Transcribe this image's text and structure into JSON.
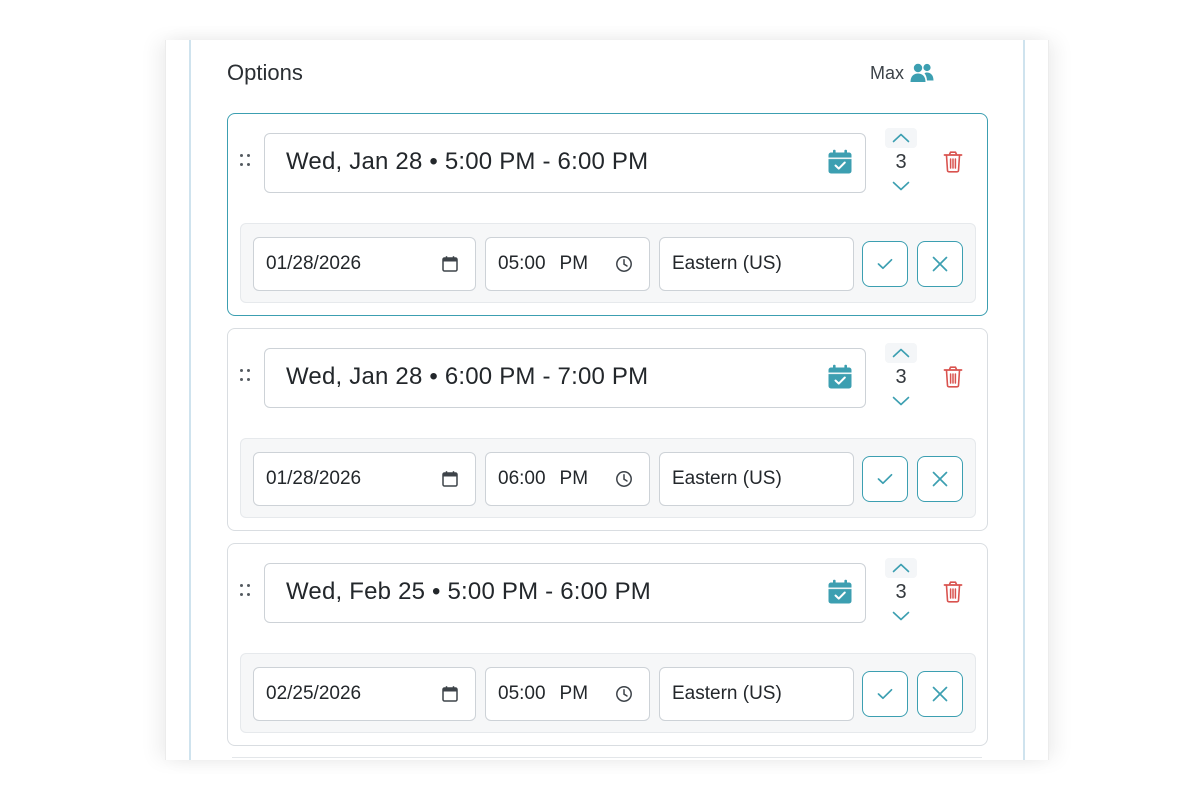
{
  "section": {
    "title": "Options",
    "max_label": "Max"
  },
  "icons": {
    "max": "people-icon",
    "summary": "calendar-check-icon",
    "delete": "trash-icon",
    "date_field": "calendar-icon",
    "time_field": "clock-icon",
    "confirm": "check-icon",
    "cancel": "close-icon",
    "drag": "drag-handle-icon"
  },
  "colors": {
    "accent": "#3c9fb1",
    "danger": "#d9534f"
  },
  "options": [
    {
      "summary": "Wed, Jan 28 • 5:00 PM - 6:00 PM",
      "max": "3",
      "date": "01/28/2026",
      "time": "05:00",
      "ampm": "PM",
      "timezone": "Eastern (US)",
      "active": true
    },
    {
      "summary": "Wed, Jan 28 • 6:00 PM - 7:00 PM",
      "max": "3",
      "date": "01/28/2026",
      "time": "06:00",
      "ampm": "PM",
      "timezone": "Eastern (US)",
      "active": false
    },
    {
      "summary": "Wed, Feb 25 • 5:00 PM - 6:00 PM",
      "max": "3",
      "date": "02/25/2026",
      "time": "05:00",
      "ampm": "PM",
      "timezone": "Eastern (US)",
      "active": false
    }
  ]
}
